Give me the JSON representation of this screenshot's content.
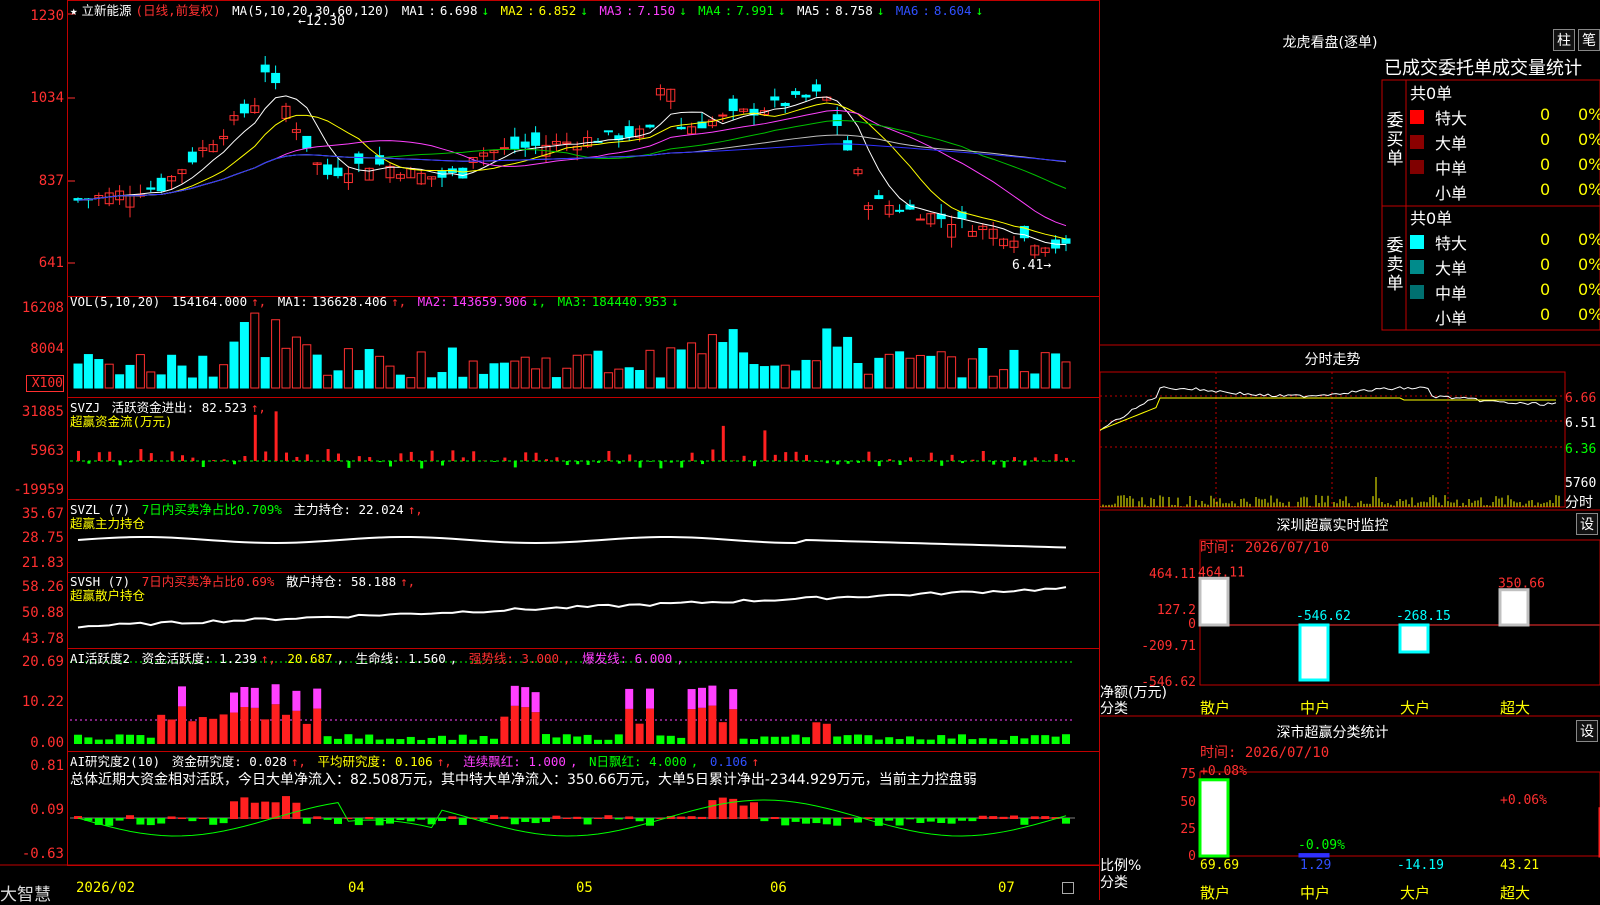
{
  "stock": {
    "name": "立新能源",
    "mode": "(日线,前复权)",
    "high_mark": "12.30",
    "low_mark": "6.41"
  },
  "ma": {
    "label": "MA(5,10,20,30,60,120)",
    "items": [
      {
        "name": "MA1",
        "value": "6.698",
        "dir": "↓",
        "color": "#ffffff"
      },
      {
        "name": "MA2",
        "value": "6.852",
        "dir": "↓",
        "color": "#ffff00"
      },
      {
        "name": "MA3",
        "value": "7.150",
        "dir": "↓",
        "color": "#ff40ff"
      },
      {
        "name": "MA4",
        "value": "7.991",
        "dir": "↓",
        "color": "#00ff00"
      },
      {
        "name": "MA5",
        "value": "8.758",
        "dir": "↓",
        "color": "#c0c0c0"
      },
      {
        "name": "MA6",
        "value": "8.604",
        "dir": "↓",
        "color": "#3050ff"
      }
    ]
  },
  "price_axis": [
    "1230",
    "1034",
    "837",
    "641"
  ],
  "vol": {
    "label": "VOL(5,10,20)",
    "value": "154164.000",
    "ma1": "136628.406",
    "ma2": "143659.906",
    "ma3": "184440.953",
    "axis": [
      "16208",
      "8004",
      "X100"
    ]
  },
  "svzj": {
    "label": "SVZJ",
    "text": "活跃资金进出: 82.523",
    "sub": "超赢资金流(万元)",
    "axis": [
      "31885",
      "5963",
      "-19959"
    ]
  },
  "svzl": {
    "label": "SVZL (7)",
    "text1": "7日内买卖净占比0.709%",
    "text2": "主力持仓: 22.024",
    "sub": "超赢主力持仓",
    "axis": [
      "35.67",
      "28.75",
      "21.83"
    ]
  },
  "svsh": {
    "label": "SVSH (7)",
    "text1": "7日内买卖净占比0.69%",
    "text2": "散户持仓: 58.188",
    "sub": "超赢散户持仓",
    "axis": [
      "58.26",
      "50.88",
      "43.78"
    ]
  },
  "ai1": {
    "label": "AI活跃度2",
    "t1": "资金活跃度: 1.239",
    "t2": "20.687",
    "t3": "生命线: 1.560",
    "t4": "强势线: 3.000",
    "t5": "爆发线: 6.000",
    "axis": [
      "20.69",
      "10.22",
      "0.00"
    ]
  },
  "ai2": {
    "label": "AI研究度2(10)",
    "t1": "资金研究度: 0.028",
    "t2": "平均研究度: 0.106",
    "t3": "连续飘红: 1.000",
    "t4": "N日飘红: 4.000",
    "t5": "0.106",
    "summary": "总体近期大资金相对活跃，今日大单净流入：82.508万元，其中特大单净流入：350.66万元，大单5日累计净出-2344.929万元，当前主力控盘弱",
    "axis": [
      "0.81",
      "0.09",
      "-0.63"
    ]
  },
  "x_axis": [
    "2026/02",
    "04",
    "05",
    "06",
    "07"
  ],
  "brand": "大智慧",
  "lhb": {
    "title": "龙虎看盘(逐单)",
    "btn_bar": "柱",
    "btn_pen": "笔",
    "tabs": "已成交委托单成交量统计",
    "buy_label": "委买单",
    "sell_label": "委卖单",
    "buy_total": "共0单",
    "sell_total": "共0单",
    "buy_rows": [
      {
        "name": "特大",
        "v": "0",
        "p": "0%",
        "color": "#ff0000"
      },
      {
        "name": "大单",
        "v": "0",
        "p": "0%",
        "color": "#8b0000"
      },
      {
        "name": "中单",
        "v": "0",
        "p": "0%",
        "color": "#800000"
      },
      {
        "name": "小单",
        "v": "0",
        "p": "0%",
        "color": "#000000"
      }
    ],
    "sell_rows": [
      {
        "name": "特大",
        "v": "0",
        "p": "0%",
        "color": "#00ffff"
      },
      {
        "name": "大单",
        "v": "0",
        "p": "0%",
        "color": "#008b8b"
      },
      {
        "name": "中单",
        "v": "0",
        "p": "0%",
        "color": "#007070"
      },
      {
        "name": "小单",
        "v": "0",
        "p": "0%",
        "color": "#000000"
      }
    ]
  },
  "fenshi": {
    "title": "分时走势",
    "axis": [
      "6.66",
      "6.51",
      "6.36"
    ],
    "vol_axis": "5760",
    "vol_label": "分时"
  },
  "monitor": {
    "title": "深圳超赢实时监控",
    "btn": "设",
    "time": "时间: 2026/07/10",
    "axis": [
      "464.11",
      "127.2",
      "0",
      "-209.71",
      "-546.62"
    ],
    "ylabel": "净额(万元)",
    "xlabel": "分类",
    "bars": [
      {
        "name": "散户",
        "value": 464.11,
        "label": "464.11"
      },
      {
        "name": "中户",
        "value": -546.62,
        "label": "-546.62"
      },
      {
        "name": "大户",
        "value": -268.15,
        "label": "-268.15"
      },
      {
        "name": "超大",
        "value": 350.66,
        "label": "350.66"
      }
    ]
  },
  "classify": {
    "title": "深市超赢分类统计",
    "btn": "设",
    "time": "时间: 2026/07/10",
    "axis": [
      "75",
      "50",
      "25",
      "0"
    ],
    "ylabel": "比例%",
    "xlabel": "分类",
    "bars": [
      {
        "name": "散户",
        "pct": 69.69,
        "top": "+0.08%",
        "bottom": "69.69"
      },
      {
        "name": "中户",
        "pct": 1.29,
        "top": "-0.09%",
        "bottom": "1.29"
      },
      {
        "name": "大户",
        "pct": -14.19,
        "top": "",
        "bottom": "-14.19"
      },
      {
        "name": "超大",
        "pct": 43.21,
        "top": "+0.06%",
        "bottom": "43.21"
      }
    ]
  }
}
